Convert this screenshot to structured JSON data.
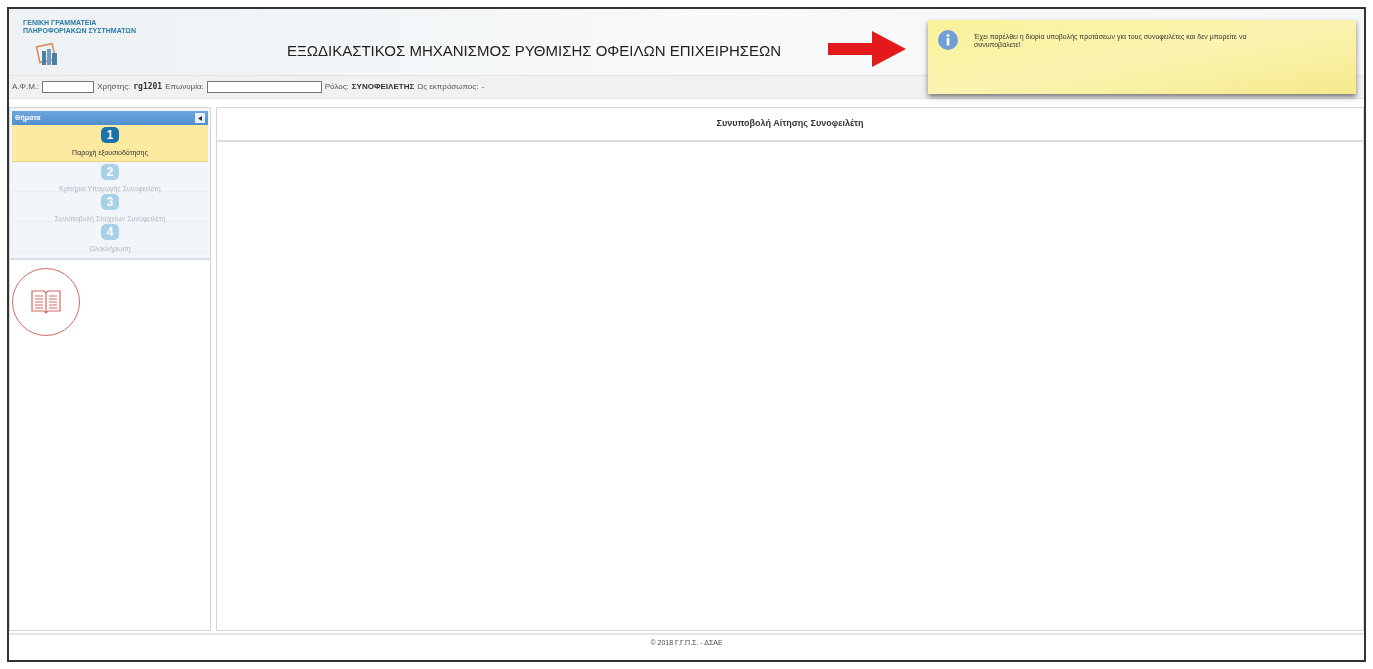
{
  "header": {
    "org_line_1": "ΓΕΝΙΚΗ ΓΡΑΜΜΑΤΕΙΑ",
    "org_line_2": "ΠΛΗΡΟΦΟΡΙΑΚΩΝ ΣΥΣΤΗΜΑΤΩΝ",
    "title": "ΕΞΩΔΙΚΑΣΤΙΚΟΣ ΜΗΧΑΝΙΣΜΟΣ ΡΥΘΜΙΣΗΣ ΟΦΕΙΛΩΝ ΕΠΙΧΕΙΡΗΣΕΩΝ"
  },
  "info_bar": {
    "afm_label": "Α.Φ.Μ.:",
    "user_label": "Χρήστης:",
    "user": "rg1201",
    "name_label": "Επωνυμία:",
    "role_label": "Ρόλος:",
    "role": "ΣΥΝΟΦΕΙΛΕΤΗΣ",
    "rep_label": "Ως εκπρόσωπος:",
    "rep": "-"
  },
  "notification": {
    "message": "Έχει παρέλθει η διορία υποβολής προτάσεων για τους συνοφειλέτες και δεν μπορείτε να συνυποβάλετε!"
  },
  "sidebar": {
    "title": "Θήματα",
    "steps": [
      {
        "number": "1",
        "label": "Παροχή εξουσιοδότησης",
        "selected": true
      },
      {
        "number": "2",
        "label": "Κριτήρια Υπαγωγής Συνοφειλέτη",
        "selected": false
      },
      {
        "number": "3",
        "label": "Συνυποβολή Στοιχείων Συνοφειλέτη",
        "selected": false
      },
      {
        "number": "4",
        "label": "Ολοκλήρωση",
        "selected": false
      }
    ]
  },
  "main": {
    "title": "Συνυποβολή Αίτησης Συνοφειλέτη"
  },
  "footer": "© 2018 Γ.Γ.Π.Σ. - ΔΣΑΕ"
}
